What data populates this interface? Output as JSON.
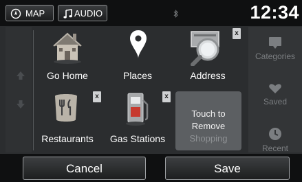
{
  "topbar": {
    "map_label": "MAP",
    "audio_label": "AUDIO",
    "clock": "12:34"
  },
  "tiles": [
    {
      "label": "Go Home",
      "icon": "house-icon",
      "removable": false
    },
    {
      "label": "Places",
      "icon": "location-pin-icon",
      "removable": false
    },
    {
      "label": "Address",
      "icon": "address-magnifier-icon",
      "removable": true,
      "delete_label": "x"
    },
    {
      "label": "Restaurants",
      "icon": "restaurant-icon",
      "removable": true,
      "delete_label": "x"
    },
    {
      "label": "Gas Stations",
      "icon": "gas-pump-icon",
      "removable": true,
      "delete_label": "x"
    }
  ],
  "remove_tile": {
    "line1": "Touch to",
    "line2": "Remove",
    "line3": "Shopping"
  },
  "sidebar": {
    "items": [
      {
        "label": "Categories",
        "icon": "categories-icon"
      },
      {
        "label": "Saved",
        "icon": "heart-icon"
      },
      {
        "label": "Recent",
        "icon": "clock-icon"
      }
    ]
  },
  "bottom": {
    "cancel_label": "Cancel",
    "save_label": "Save"
  },
  "colors": {
    "background": "#2b2d2f",
    "bar": "#0f1011",
    "sidebar_text": "#7b7e81"
  }
}
